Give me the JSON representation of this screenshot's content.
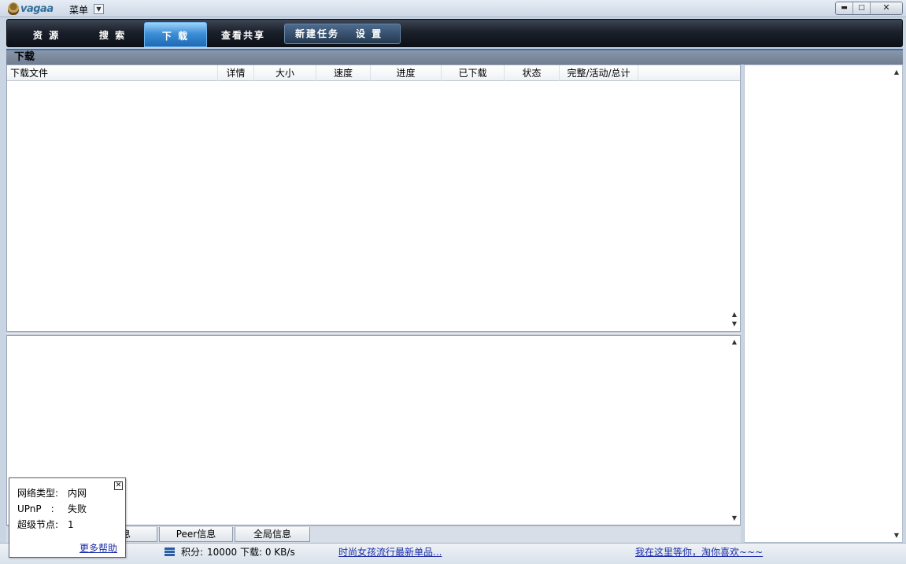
{
  "app": {
    "logo_text": "vagaa",
    "menu_label": "菜单"
  },
  "window_controls": {
    "minimize": "▬",
    "maximize": "□",
    "close": "✕"
  },
  "nav": {
    "tabs": [
      {
        "label": "资 源",
        "active": false
      },
      {
        "label": "搜 索",
        "active": false
      },
      {
        "label": "下 载",
        "active": true
      },
      {
        "label": "查看共享",
        "active": false
      }
    ],
    "group": [
      {
        "label": "新建任务"
      },
      {
        "label": "设 置"
      }
    ]
  },
  "section_title": "下载",
  "download_list": {
    "columns": [
      "下载文件",
      "详情",
      "大小",
      "速度",
      "进度",
      "已下载",
      "状态",
      "完整/活动/总计"
    ],
    "rows": []
  },
  "bottom_tabs": [
    "信息",
    "Peer信息",
    "全局信息"
  ],
  "status": {
    "points_label": "积分:",
    "points_value": "10000",
    "download_speed": "下载: 0 KB/s",
    "link1": "时尚女孩流行最新单品...",
    "link2": "我在这里等你，淘你喜欢~~~"
  },
  "network_popup": {
    "rows": [
      {
        "key": "网络类型:",
        "value": "内网"
      },
      {
        "key": "UPnP　:",
        "value": "失败"
      },
      {
        "key": "超级节点:",
        "value": "1"
      }
    ],
    "help_link": "更多帮助"
  }
}
